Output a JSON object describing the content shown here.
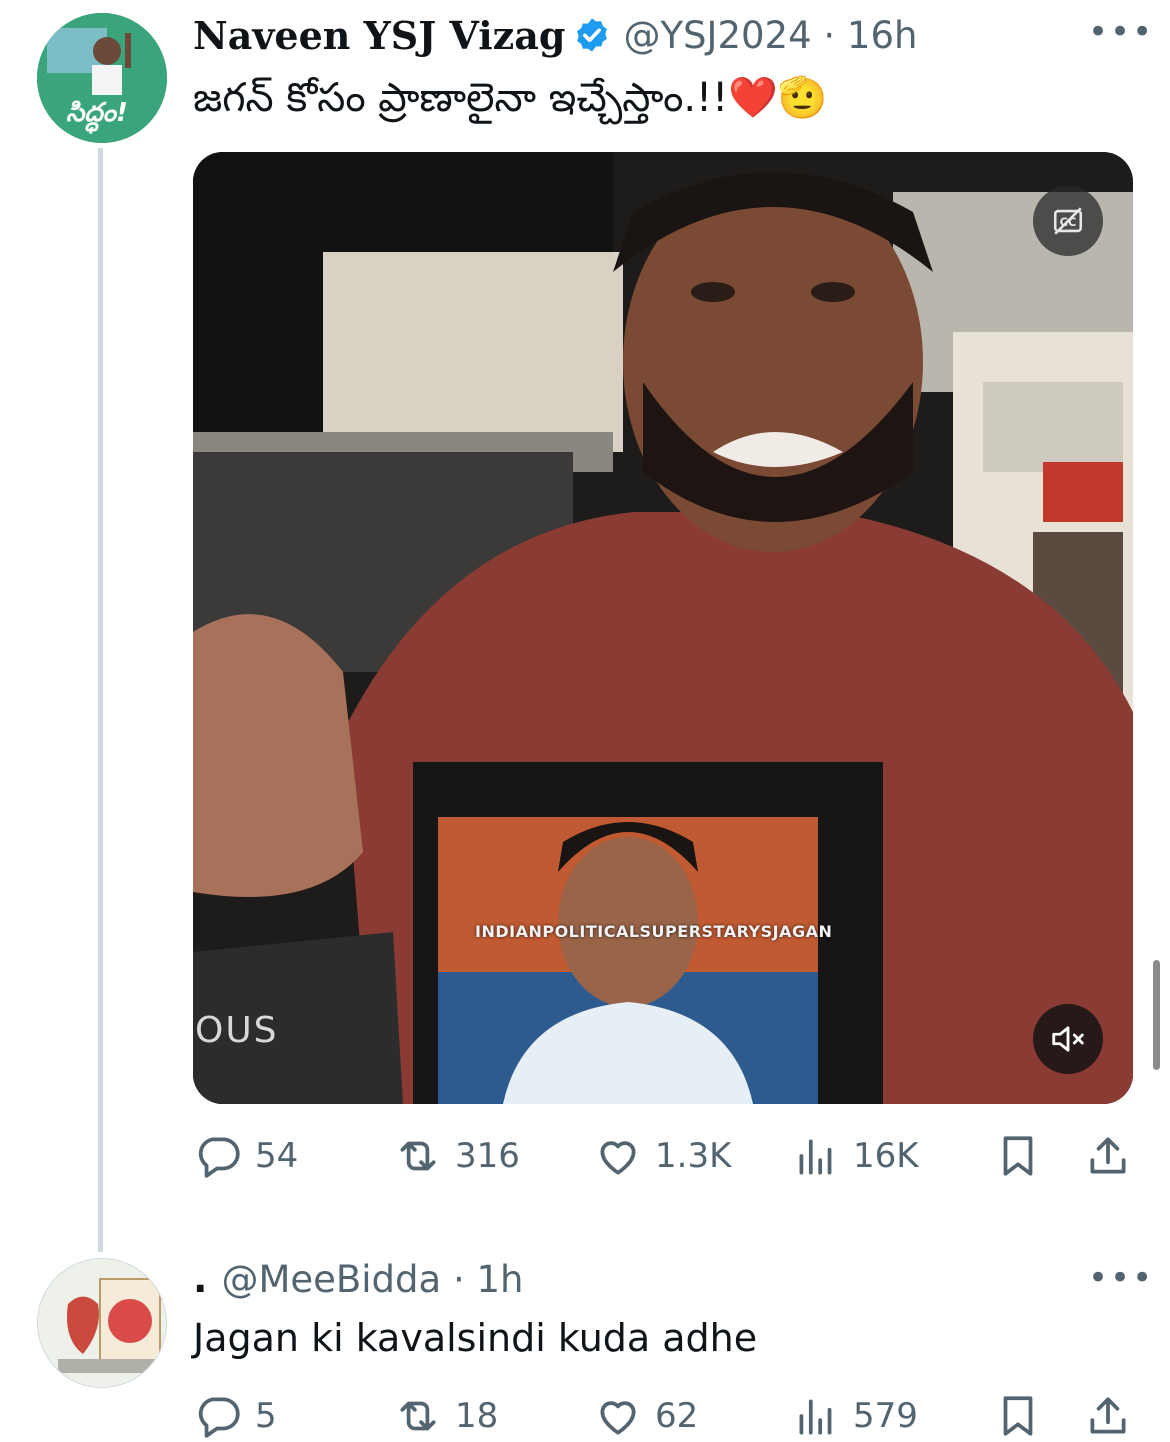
{
  "tweet": {
    "display_name": "Naveen YSJ Vizag",
    "handle": "@YSJ2024",
    "time": "16h",
    "text": "జగన్ కోసం ప్రాణాలైనా ఇచ్చేస్తాం.!!❤️🫡",
    "avatar_text": "సిద్ధం!",
    "media": {
      "watermark": "INDIANPOLITICALSUPERSTARYSJAGAN",
      "shirt_text": "OUS"
    },
    "stats": {
      "replies": "54",
      "reposts": "316",
      "likes": "1.3K",
      "views": "16K"
    }
  },
  "reply": {
    "display_name": ".",
    "handle": "@MeeBidda",
    "time": "1h",
    "text": "Jagan ki kavalsindi kuda adhe",
    "stats": {
      "replies": "5",
      "reposts": "18",
      "likes": "62",
      "views": "579"
    }
  },
  "colors": {
    "text_primary": "#0f1419",
    "text_secondary": "#536471",
    "verified_blue": "#1d9bf0",
    "thread_line": "#cfd9de"
  },
  "icons": [
    "verified-badge-icon",
    "more-icon",
    "captions-icon",
    "mute-icon",
    "reply-icon",
    "repost-icon",
    "like-icon",
    "views-icon",
    "bookmark-icon",
    "share-icon"
  ]
}
